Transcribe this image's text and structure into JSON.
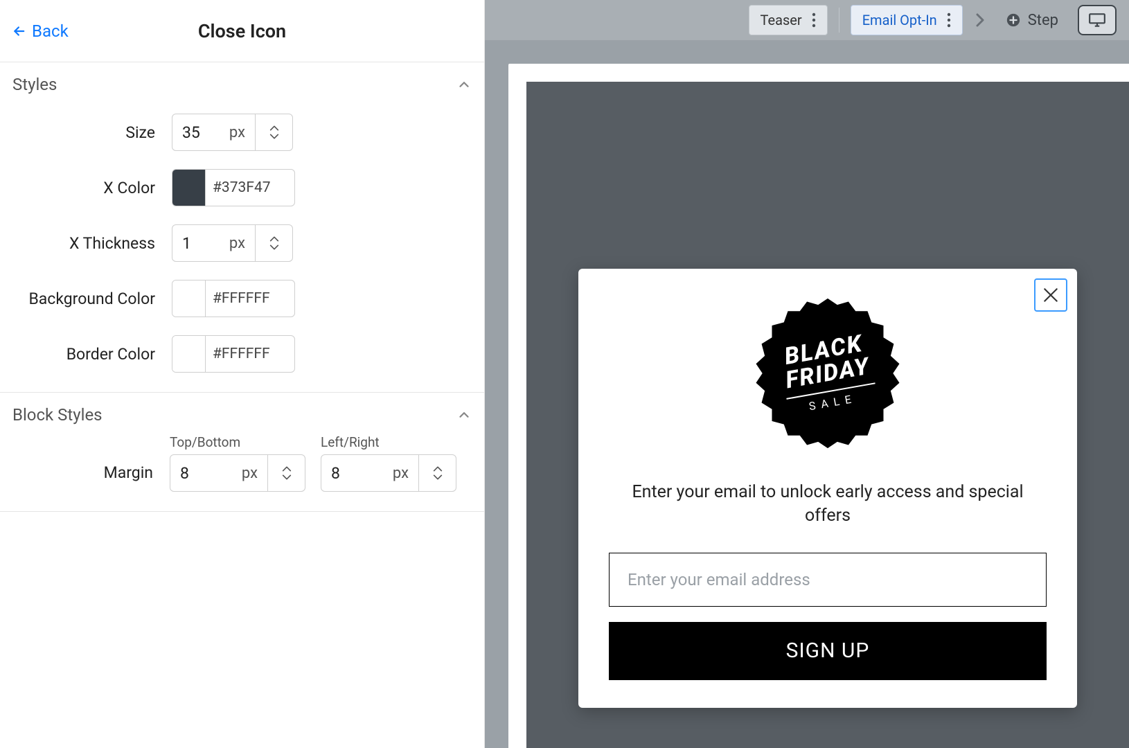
{
  "header": {
    "back": "Back",
    "title": "Close Icon"
  },
  "sections": {
    "styles": {
      "title": "Styles",
      "rows": {
        "size": {
          "label": "Size",
          "value": "35",
          "unit": "px"
        },
        "x_color": {
          "label": "X Color",
          "hex": "#373F47",
          "swatch": "#373F47"
        },
        "x_thickness": {
          "label": "X Thickness",
          "value": "1",
          "unit": "px"
        },
        "background_color": {
          "label": "Background Color",
          "hex": "#FFFFFF",
          "swatch": "#FFFFFF"
        },
        "border_color": {
          "label": "Border Color",
          "hex": "#FFFFFF",
          "swatch": "#FFFFFF"
        }
      }
    },
    "block_styles": {
      "title": "Block Styles",
      "margin": {
        "label": "Margin",
        "top_bottom": {
          "label": "Top/Bottom",
          "value": "8",
          "unit": "px"
        },
        "left_right": {
          "label": "Left/Right",
          "value": "8",
          "unit": "px"
        }
      }
    }
  },
  "toolbar": {
    "steps": {
      "teaser": "Teaser",
      "email_optin": "Email Opt-In"
    },
    "add_step": "Step"
  },
  "popup": {
    "badge": {
      "line1": "BLACK",
      "line2": "FRIDAY",
      "sale": "SALE"
    },
    "description": "Enter your email to unlock early access and special offers",
    "email_placeholder": "Enter your email address",
    "cta": "SIGN UP"
  }
}
